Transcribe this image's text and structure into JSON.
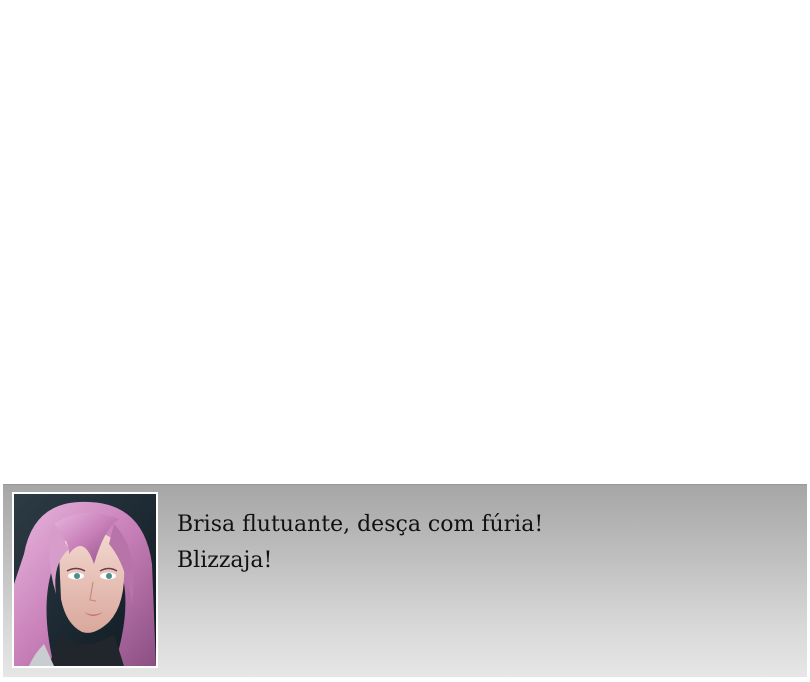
{
  "dialogue": {
    "lines": [
      "Brisa flutuante, desça com fúria!",
      "Blizzaja!"
    ],
    "portrait_icon": "character-portrait-pink-hair"
  },
  "colors": {
    "box_top": "#a6a6a6",
    "box_bottom": "#e6e6e6",
    "text": "#111111",
    "frame": "#ffffff"
  }
}
